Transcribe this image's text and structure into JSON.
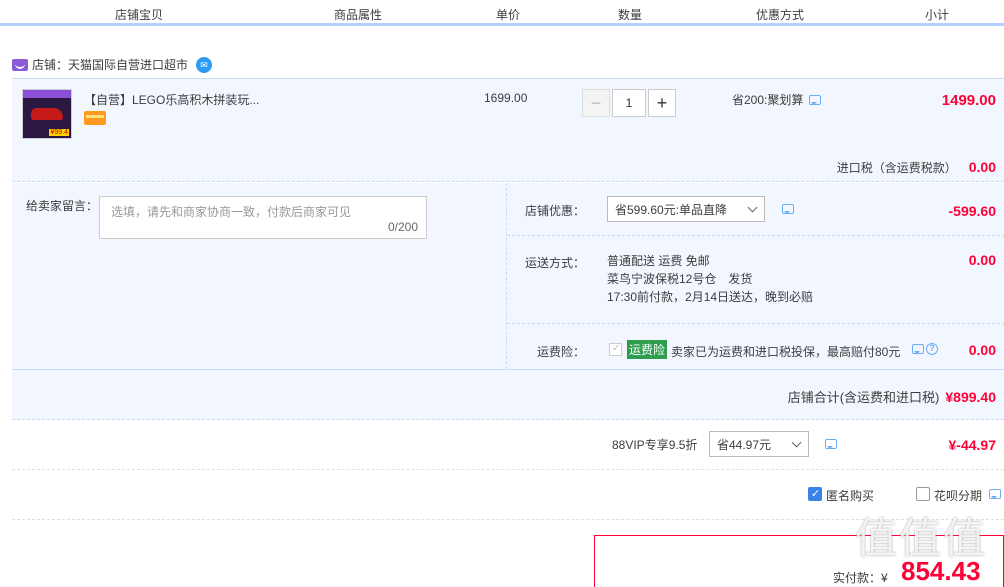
{
  "header": {
    "cols": [
      "店铺宝贝",
      "商品属性",
      "单价",
      "数量",
      "优惠方式",
      "小计"
    ]
  },
  "shop": {
    "label": "店铺：天猫国际自营进口超市",
    "icon": "tmall-cat-icon",
    "chat_icon": "wangwang-icon"
  },
  "item": {
    "thumb_price": "¥99.4",
    "title": "【自营】LEGO乐高积木拼装玩...",
    "unit_price": "1699.00",
    "qty": "1",
    "promo": "省200:聚划算",
    "subtotal": "1499.00",
    "tax_label": "进口税（含运费税款）",
    "tax_value": "0.00"
  },
  "message": {
    "label": "给卖家留言：",
    "placeholder": "选填，请先和商家协商一致，付款后商家可见",
    "count": "0/200"
  },
  "shop_discount": {
    "label": "店铺优惠：",
    "selected": "省599.60元:单品直降",
    "value": "-599.60"
  },
  "shipping": {
    "label": "运送方式：",
    "line1": "普通配送 运费 免邮",
    "line2": "菜鸟宁波保税12号仓　发货",
    "line3": "17:30前付款，2月14日送达，晚到必赔",
    "value": "0.00"
  },
  "insurance": {
    "label": "运费险：",
    "tag": "运费险",
    "text": "卖家已为运费和进口税投保，最高赔付80元",
    "value": "0.00"
  },
  "shop_total": {
    "label": "店铺合计(含运费和进口税)",
    "value": "¥899.40"
  },
  "vip": {
    "label": "88VIP专享9.5折",
    "selected": "省44.97元",
    "value": "¥-44.97"
  },
  "options": {
    "anonymous": "匿名购买",
    "installment": "花呗分期"
  },
  "pay": {
    "label": "实付款：¥",
    "amount": "854.43"
  },
  "watermark": "值值值",
  "colors": {
    "accent_red": "#ff0036",
    "header_line": "#b2d1ff",
    "panel_bg": "#f2f7ff"
  }
}
